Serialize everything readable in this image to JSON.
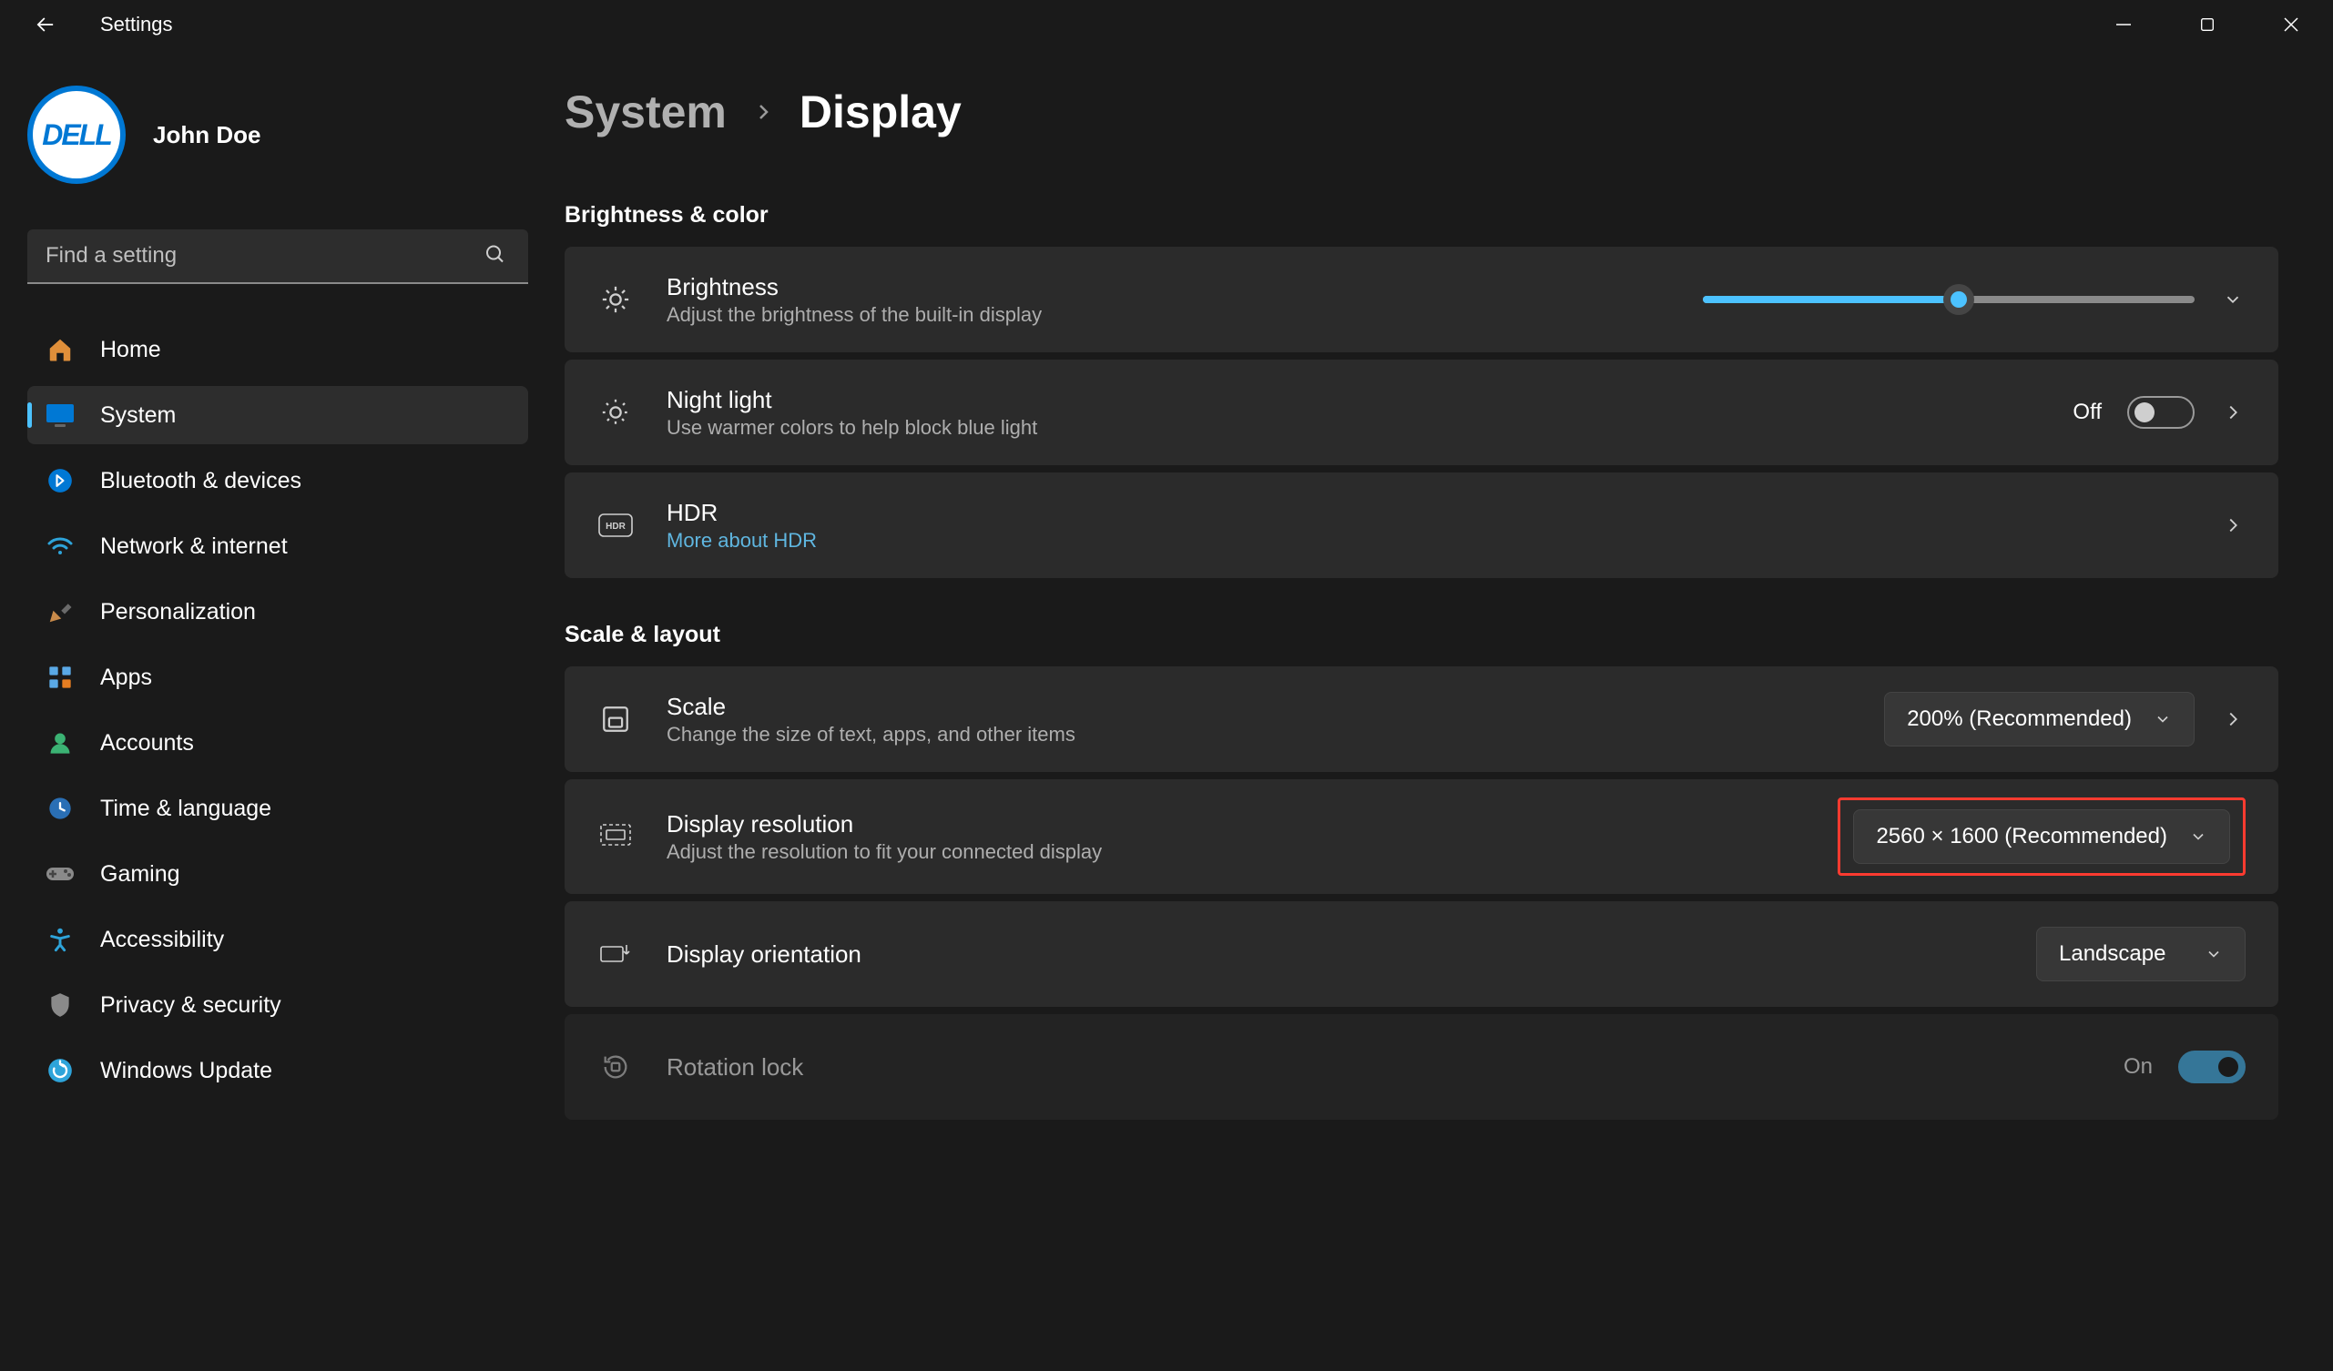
{
  "window": {
    "title": "Settings"
  },
  "user": {
    "name": "John Doe",
    "avatar_text": "DELL"
  },
  "search": {
    "placeholder": "Find a setting"
  },
  "nav": {
    "home": "Home",
    "system": "System",
    "bluetooth": "Bluetooth & devices",
    "network": "Network & internet",
    "personalization": "Personalization",
    "apps": "Apps",
    "accounts": "Accounts",
    "time": "Time & language",
    "gaming": "Gaming",
    "accessibility": "Accessibility",
    "privacy": "Privacy & security",
    "update": "Windows Update"
  },
  "breadcrumb": {
    "parent": "System",
    "current": "Display"
  },
  "sections": {
    "brightness_color": "Brightness & color",
    "scale_layout": "Scale & layout"
  },
  "cards": {
    "brightness": {
      "title": "Brightness",
      "sub": "Adjust the brightness of the built-in display",
      "slider_percent": 52
    },
    "nightlight": {
      "title": "Night light",
      "sub": "Use warmer colors to help block blue light",
      "state_label": "Off",
      "state": "off"
    },
    "hdr": {
      "title": "HDR",
      "link": "More about HDR"
    },
    "scale": {
      "title": "Scale",
      "sub": "Change the size of text, apps, and other items",
      "value": "200% (Recommended)"
    },
    "resolution": {
      "title": "Display resolution",
      "sub": "Adjust the resolution to fit your connected display",
      "value": "2560 × 1600 (Recommended)"
    },
    "orientation": {
      "title": "Display orientation",
      "value": "Landscape"
    },
    "rotation": {
      "title": "Rotation lock",
      "state_label": "On",
      "state": "on"
    }
  },
  "colors": {
    "accent": "#4cc2ff",
    "highlight": "#ff3b30"
  }
}
